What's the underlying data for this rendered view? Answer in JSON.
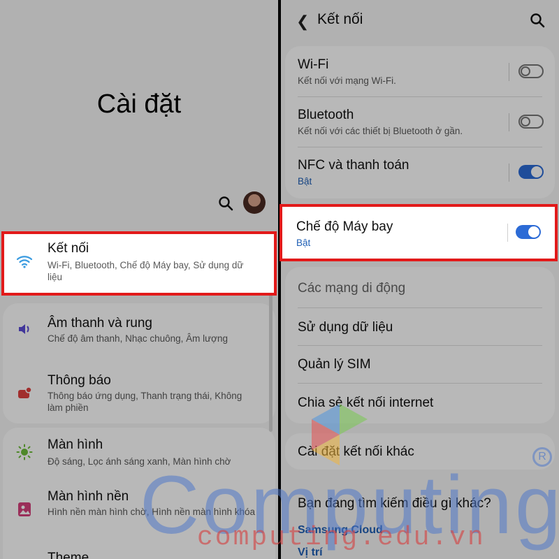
{
  "left": {
    "title": "Cài đặt",
    "items": [
      {
        "title": "Kết nối",
        "subtitle": "Wi-Fi, Bluetooth, Chế độ Máy bay, Sử dụng dữ liệu",
        "icon": "wifi-icon"
      },
      {
        "title": "Âm thanh và rung",
        "subtitle": "Chế độ âm thanh, Nhạc chuông, Âm lượng",
        "icon": "sound-icon"
      },
      {
        "title": "Thông báo",
        "subtitle": "Thông báo ứng dụng, Thanh trạng thái, Không làm phiền",
        "icon": "notification-icon"
      },
      {
        "title": "Màn hình",
        "subtitle": "Độ sáng, Lọc ánh sáng xanh, Màn hình chờ",
        "icon": "brightness-icon"
      },
      {
        "title": "Màn hình nền",
        "subtitle": "Hình nền màn hình chờ, Hình nền màn hình khóa",
        "icon": "wallpaper-icon"
      },
      {
        "title": "Theme",
        "icon": "theme-icon"
      }
    ]
  },
  "right": {
    "header_title": "Kết nối",
    "wifi": {
      "title": "Wi-Fi",
      "subtitle": "Kết nối với mạng Wi-Fi.",
      "state": "off"
    },
    "bluetooth": {
      "title": "Bluetooth",
      "subtitle": "Kết nối với các thiết bị Bluetooth ở gần.",
      "state": "off"
    },
    "nfc": {
      "title": "NFC và thanh toán",
      "subtitle": "Bật",
      "state": "on"
    },
    "airplane": {
      "title": "Chế độ Máy bay",
      "subtitle": "Bật",
      "state": "on"
    },
    "mobile_networks": "Các mạng di động",
    "data_usage": "Sử dụng dữ liệu",
    "sim_manager": "Quản lý SIM",
    "hotspot": "Chia sẻ kết nối internet",
    "more_settings": "Cài đặt kết nối khác",
    "looking_for": "Bạn đang tìm kiếm điều gì khác?",
    "samsung_cloud": "Samsung Cloud",
    "location": "Vị trí"
  },
  "watermark": {
    "brand": "Computing",
    "site": "computing.edu.vn",
    "registered": "R"
  },
  "colors": {
    "highlight": "#e21a1a",
    "toggle_on": "#2c6bd6",
    "link": "#1f5fb5"
  }
}
